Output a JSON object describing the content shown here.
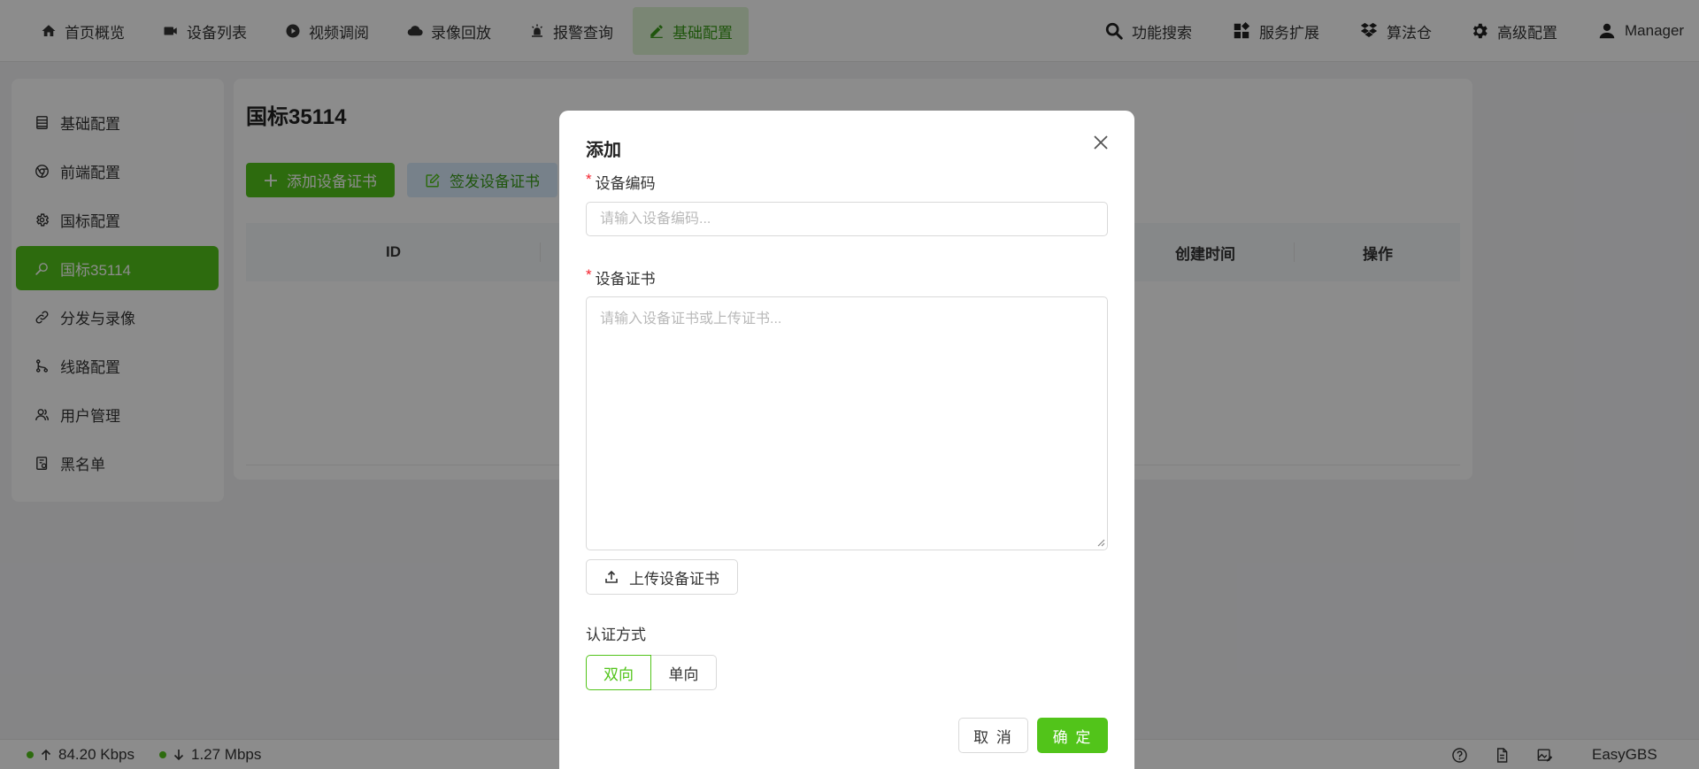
{
  "nav": {
    "items": [
      {
        "label": "首页概览",
        "icon": "home-icon"
      },
      {
        "label": "设备列表",
        "icon": "camera-icon"
      },
      {
        "label": "视频调阅",
        "icon": "play-circle-icon"
      },
      {
        "label": "录像回放",
        "icon": "cloud-icon"
      },
      {
        "label": "报警查询",
        "icon": "alarm-icon"
      },
      {
        "label": "基础配置",
        "icon": "edit-icon",
        "active": true
      }
    ],
    "right": [
      {
        "label": "功能搜索",
        "icon": "search-icon"
      },
      {
        "label": "服务扩展",
        "icon": "apps-icon"
      },
      {
        "label": "算法仓",
        "icon": "dropbox-icon"
      },
      {
        "label": "高级配置",
        "icon": "gear-icon"
      },
      {
        "label": "Manager",
        "icon": "user-icon"
      }
    ]
  },
  "sidebar": {
    "items": [
      {
        "label": "基础配置",
        "icon": "list-icon"
      },
      {
        "label": "前端配置",
        "icon": "chrome-icon"
      },
      {
        "label": "国标配置",
        "icon": "settings-icon"
      },
      {
        "label": "国标35114",
        "icon": "search-icon",
        "active": true
      },
      {
        "label": "分发与录像",
        "icon": "link-icon"
      },
      {
        "label": "线路配置",
        "icon": "branch-icon"
      },
      {
        "label": "用户管理",
        "icon": "users-icon"
      },
      {
        "label": "黑名单",
        "icon": "blacklist-icon"
      }
    ]
  },
  "main": {
    "title": "国标35114",
    "add_button": "添加设备证书",
    "issue_button": "签发设备证书",
    "columns": [
      "ID",
      "创建时间",
      "操作"
    ]
  },
  "modal": {
    "title": "添加",
    "code_label": "设备编码",
    "code_placeholder": "请输入设备编码...",
    "code_value": "",
    "cert_label": "设备证书",
    "cert_placeholder": "请输入设备证书或上传证书...",
    "cert_value": "",
    "upload_button": "上传设备证书",
    "auth_label": "认证方式",
    "auth_options": [
      "双向",
      "单向"
    ],
    "auth_selected": "双向",
    "cancel_button": "取 消",
    "ok_button": "确 定"
  },
  "status": {
    "upload_rate": "84.20 Kbps",
    "download_rate": "1.27 Mbps",
    "brand": "EasyGBS"
  },
  "colors": {
    "primary": "#52c41a",
    "active_nav_bg": "#dff4d3",
    "required": "#f5222d"
  }
}
